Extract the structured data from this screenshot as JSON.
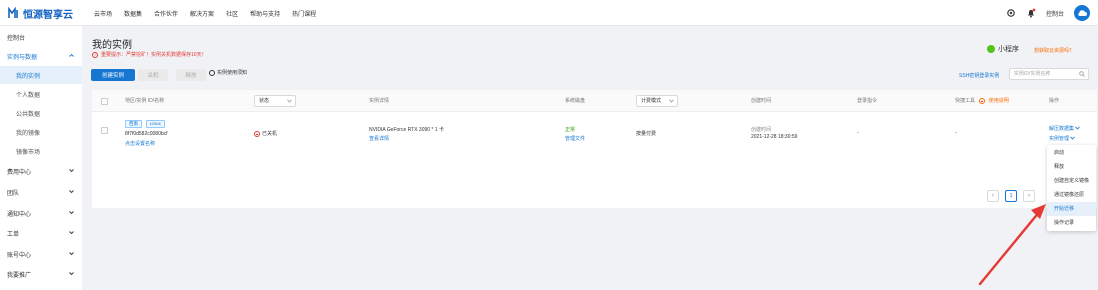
{
  "brand": {
    "name": "恒源智享云",
    "color": "#1565c0"
  },
  "nav": {
    "items": [
      "云市场",
      "数据集",
      "合作伙伴",
      "解决方案",
      "社区",
      "帮助与支持",
      "热门课程"
    ]
  },
  "top_right": {
    "console": "控制台"
  },
  "sidebar": {
    "console": "控制台",
    "instances_group": "实例与数据",
    "my_instances": "我的实例",
    "personal_data": "个人数据",
    "public_data": "公共数据",
    "my_images": "我的镜像",
    "image_market": "镜像市场",
    "billing": "费用中心",
    "team": "团队",
    "notifications": "通知中心",
    "tickets": "工单",
    "account": "账号中心",
    "promotion": "我要推广"
  },
  "page": {
    "title": "我的实例",
    "warning": "重要提示：严禁挖矿！实例关机数据保存10天！",
    "mini_program": "小程序",
    "mini_program_ask": "想获取云资源吗？",
    "create_button": "创建实例",
    "shutdown_button": "关机",
    "release_button": "释放",
    "usage_notice": "实例使用须知",
    "ssh_link": "SSH密钥登录实例",
    "search_placeholder": "实例ID/实例名称"
  },
  "table": {
    "headers": {
      "region_id_name": "地区/实例 ID/名称",
      "status": "状态",
      "instance_detail": "实例详情",
      "system_disk": "系统磁盘",
      "billing_mode": "计费模式",
      "created_at": "创建时间",
      "login_cmd": "登录指令",
      "quick_tools": "快捷工具",
      "usage_guide": "使用说明",
      "actions": "操作"
    },
    "row": {
      "region_tag": "西南",
      "os_tag": "Linux",
      "instance_id": "8f7f0d582c0080bcf",
      "set_name_link": "点击设置名称",
      "status": "已关机",
      "gpu": "NVIDIA GeForce RTX 3090 * 1 卡",
      "view_detail": "查看详情",
      "disk_status": "正常",
      "manage_files": "管理文件",
      "billing": "按量付费",
      "created_label": "创建时间",
      "created_value": "2021-12-28 18:30:59",
      "login_cmd": "-",
      "quick_tools": "-",
      "unzip_data": "解压数据集",
      "instance_manage": "实例管理"
    },
    "pagination": {
      "current": "1",
      "prev": "<",
      "next": ">"
    }
  },
  "dropdown_menu": {
    "items": [
      "启动",
      "释放",
      "创建自定义镜像",
      "通过镜像还原",
      "开始迁移",
      "操作记录"
    ],
    "highlighted": "开始迁移"
  },
  "colors": {
    "accent": "#1677d2",
    "danger": "#e53935",
    "success": "#52c41a",
    "arrow": "#e53935"
  }
}
